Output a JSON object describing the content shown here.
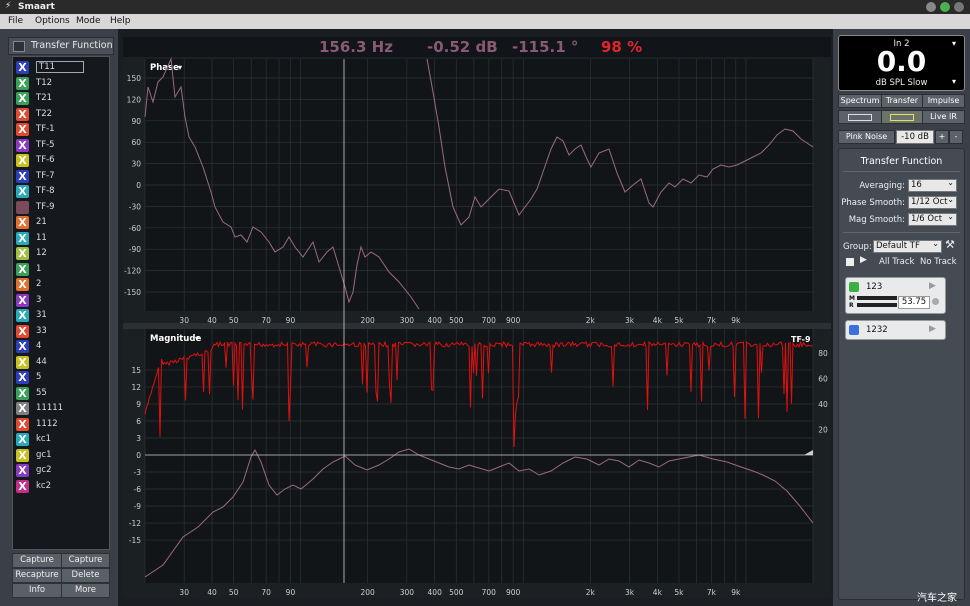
{
  "window": {
    "title": "Smaart"
  },
  "menu": {
    "items": [
      "File",
      "Options",
      "Mode",
      "Help"
    ]
  },
  "left": {
    "header": "Transfer Function",
    "traces": [
      {
        "label": "T11",
        "color": "#2c3fb8"
      },
      {
        "label": "T12",
        "color": "#3aa05a"
      },
      {
        "label": "T21",
        "color": "#3aa05a"
      },
      {
        "label": "T22",
        "color": "#e04a30"
      },
      {
        "label": "TF-1",
        "color": "#e04a30"
      },
      {
        "label": "TF-5",
        "color": "#8a3ac0"
      },
      {
        "label": "TF-6",
        "color": "#c8c020"
      },
      {
        "label": "TF-7",
        "color": "#2c3fb8"
      },
      {
        "label": "TF-8",
        "color": "#2aaab8"
      },
      {
        "label": "TF-9",
        "color": "#7a4a5a"
      },
      {
        "label": "21",
        "color": "#e07030"
      },
      {
        "label": "11",
        "color": "#2aaab8"
      },
      {
        "label": "12",
        "color": "#a0c040"
      },
      {
        "label": "1",
        "color": "#3aa05a"
      },
      {
        "label": "2",
        "color": "#e07030"
      },
      {
        "label": "3",
        "color": "#8a3ac0"
      },
      {
        "label": "31",
        "color": "#2aaab8"
      },
      {
        "label": "33",
        "color": "#e04a30"
      },
      {
        "label": "4",
        "color": "#2c3fb8"
      },
      {
        "label": "44",
        "color": "#c8c020"
      },
      {
        "label": "5",
        "color": "#2c3fb8"
      },
      {
        "label": "55",
        "color": "#3aa05a"
      },
      {
        "label": "11111",
        "color": "#808080"
      },
      {
        "label": "1112",
        "color": "#e04a30"
      },
      {
        "label": "kc1",
        "color": "#2aaab8"
      },
      {
        "label": "gc1",
        "color": "#c8c020"
      },
      {
        "label": "gc2",
        "color": "#8a3ac0"
      },
      {
        "label": "kc2",
        "color": "#c0308a"
      }
    ],
    "buttons": {
      "capture": "Capture",
      "capture_all": "Capture All",
      "recapture": "Recapture",
      "delete": "Delete",
      "info": "Info",
      "more": "More"
    }
  },
  "readout": {
    "freq": "156.3 Hz",
    "mag": "-0.52 dB",
    "phase": "-115.1 °",
    "coherence": "98 %"
  },
  "phase_plot": {
    "label": "Phase",
    "y_ticks": [
      "150",
      "120",
      "90",
      "60",
      "30",
      "0",
      "-30",
      "-60",
      "-90",
      "-120",
      "-150"
    ],
    "x_ticks": [
      "30",
      "40",
      "50",
      "70",
      "90",
      "200",
      "300",
      "400",
      "500",
      "700",
      "900",
      "2k",
      "3k",
      "4k",
      "5k",
      "7k",
      "9k"
    ]
  },
  "mag_plot": {
    "label": "Magnitude",
    "trace_label": "TF-9",
    "y_ticks": [
      "15",
      "12",
      "9",
      "6",
      "3",
      "0",
      "-3",
      "-6",
      "-9",
      "-12",
      "-15"
    ],
    "coh_ticks": [
      "80",
      "60",
      "40",
      "20"
    ],
    "x_ticks": [
      "30",
      "40",
      "50",
      "70",
      "90",
      "200",
      "300",
      "400",
      "500",
      "700",
      "900",
      "2k",
      "3k",
      "4k",
      "5k",
      "7k",
      "9k"
    ]
  },
  "meter": {
    "channel": "In 2",
    "value": "0.0",
    "units": "dB SPL Slow"
  },
  "right": {
    "tabs": {
      "spectrum": "Spectrum",
      "transfer": "Transfer",
      "impulse": "Impulse"
    },
    "live_ir": "Live IR",
    "pink_noise": "Pink Noise",
    "pink_level": "-10 dB",
    "plus": "+",
    "minus": "-",
    "panel_title": "Transfer Function",
    "averaging_label": "Averaging:",
    "averaging_value": "16",
    "phase_smooth_label": "Phase Smooth:",
    "phase_smooth_value": "1/12 Oct",
    "mag_smooth_label": "Mag Smooth:",
    "mag_smooth_value": "1/6 Oct",
    "group_label": "Group:",
    "group_value": "Default TF",
    "all_track": "All Track",
    "no_track": "No Track",
    "meas1_name": "123",
    "meas1_value": "53.75",
    "meas1_m": "M",
    "meas1_r": "R",
    "meas2_name": "1232"
  },
  "watermark": "汽车之家"
}
